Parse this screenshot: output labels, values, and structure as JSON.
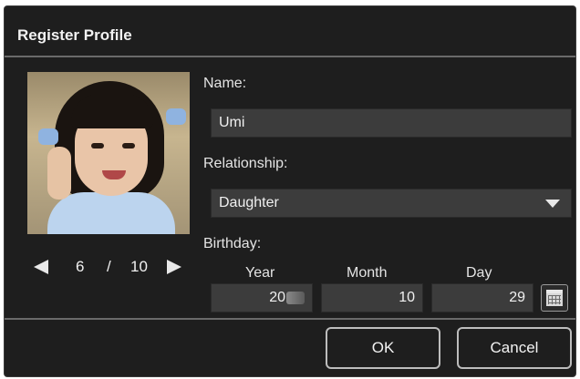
{
  "dialog": {
    "title": "Register Profile"
  },
  "photo": {
    "alt": "Profile photo of a child"
  },
  "pager": {
    "current": "6",
    "separator": "/",
    "total": "10"
  },
  "name": {
    "label": "Name:",
    "value": "Umi"
  },
  "relationship": {
    "label": "Relationship:",
    "value": "Daughter"
  },
  "birthday": {
    "label": "Birthday:",
    "year_label": "Year",
    "year_value": "20",
    "month_label": "Month",
    "month_value": "10",
    "day_label": "Day",
    "day_value": "29"
  },
  "buttons": {
    "ok": "OK",
    "cancel": "Cancel"
  },
  "icons": [
    "prev-arrow-icon",
    "next-arrow-icon",
    "dropdown-arrow-icon",
    "calendar-icon"
  ],
  "colors": {
    "background": "#1e1e1e",
    "field": "#3c3c3c",
    "text": "#e8e8e8",
    "divider": "#6a6a6a"
  }
}
